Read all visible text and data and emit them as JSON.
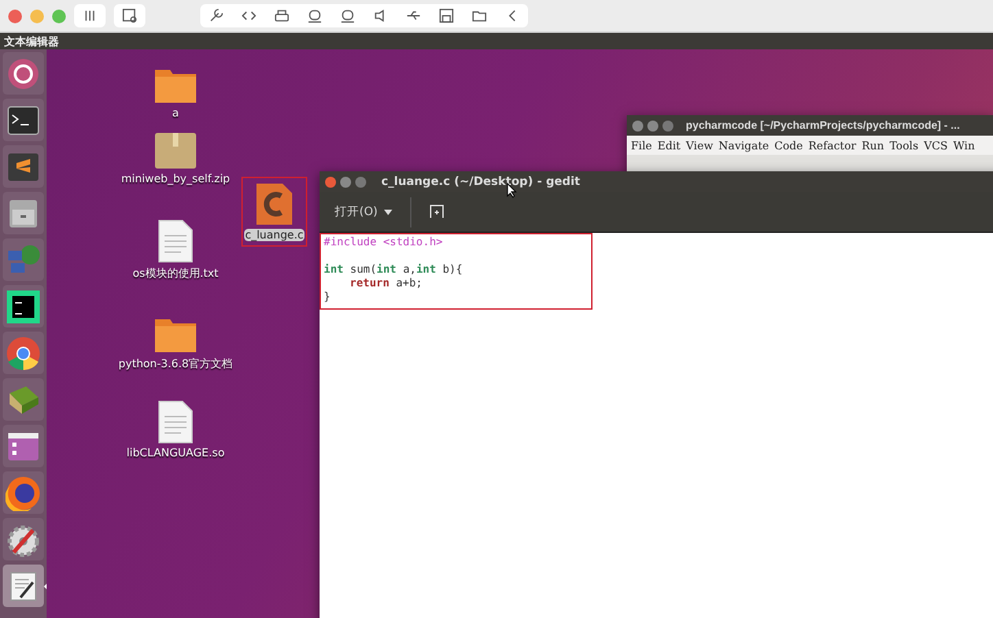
{
  "top_bar": {
    "title": "文本编辑器"
  },
  "launcher": [
    {
      "kind": "ubuntu",
      "selected": false
    },
    {
      "kind": "terminal",
      "selected": false
    },
    {
      "kind": "sublime",
      "selected": false
    },
    {
      "kind": "files",
      "selected": false
    },
    {
      "kind": "network",
      "selected": false
    },
    {
      "kind": "pycharm",
      "selected": false
    },
    {
      "kind": "chrome",
      "selected": false
    },
    {
      "kind": "book",
      "selected": false
    },
    {
      "kind": "window",
      "selected": false
    },
    {
      "kind": "firefox",
      "selected": false
    },
    {
      "kind": "settings",
      "selected": false
    },
    {
      "kind": "editor",
      "selected": true
    }
  ],
  "desktop_icons": [
    {
      "kind": "folder",
      "label": "a",
      "selected": false
    },
    {
      "kind": "zip",
      "label": "miniweb_by_self.zip",
      "selected": false
    },
    {
      "kind": "text",
      "label": "os模块的使用.txt",
      "selected": false
    },
    {
      "kind": "folder",
      "label": "python-3.6.8官方文档",
      "selected": false
    },
    {
      "kind": "text",
      "label": "libCLANGUAGE.so",
      "selected": false
    },
    {
      "kind": "cfile",
      "label": "c_luange.c",
      "selected": true
    }
  ],
  "pycharm_window": {
    "title": "pycharmcode [~/PycharmProjects/pycharmcode] - ...",
    "menu": [
      "File",
      "Edit",
      "View",
      "Navigate",
      "Code",
      "Refactor",
      "Run",
      "Tools",
      "VCS",
      "Win"
    ]
  },
  "gedit_window": {
    "title": "c_luange.c (~/Desktop) - gedit",
    "open_button": "打开(O)",
    "code": [
      {
        "gap_before": false,
        "indented": false,
        "tokens": [
          {
            "kind": "preproc",
            "text": "#include <stdio.h>"
          }
        ]
      },
      {
        "gap_before": true,
        "indented": false,
        "tokens": [
          {
            "kind": "type",
            "text": "int"
          },
          {
            "kind": "plain",
            "text": " sum("
          },
          {
            "kind": "type",
            "text": "int"
          },
          {
            "kind": "plain",
            "text": " a,"
          },
          {
            "kind": "type",
            "text": "int"
          },
          {
            "kind": "plain",
            "text": " b){"
          }
        ]
      },
      {
        "gap_before": false,
        "indented": true,
        "tokens": [
          {
            "kind": "keyword",
            "text": "return"
          },
          {
            "kind": "plain",
            "text": " a+b;"
          }
        ]
      },
      {
        "gap_before": false,
        "indented": false,
        "tokens": [
          {
            "kind": "plain",
            "text": "}"
          }
        ]
      }
    ]
  }
}
